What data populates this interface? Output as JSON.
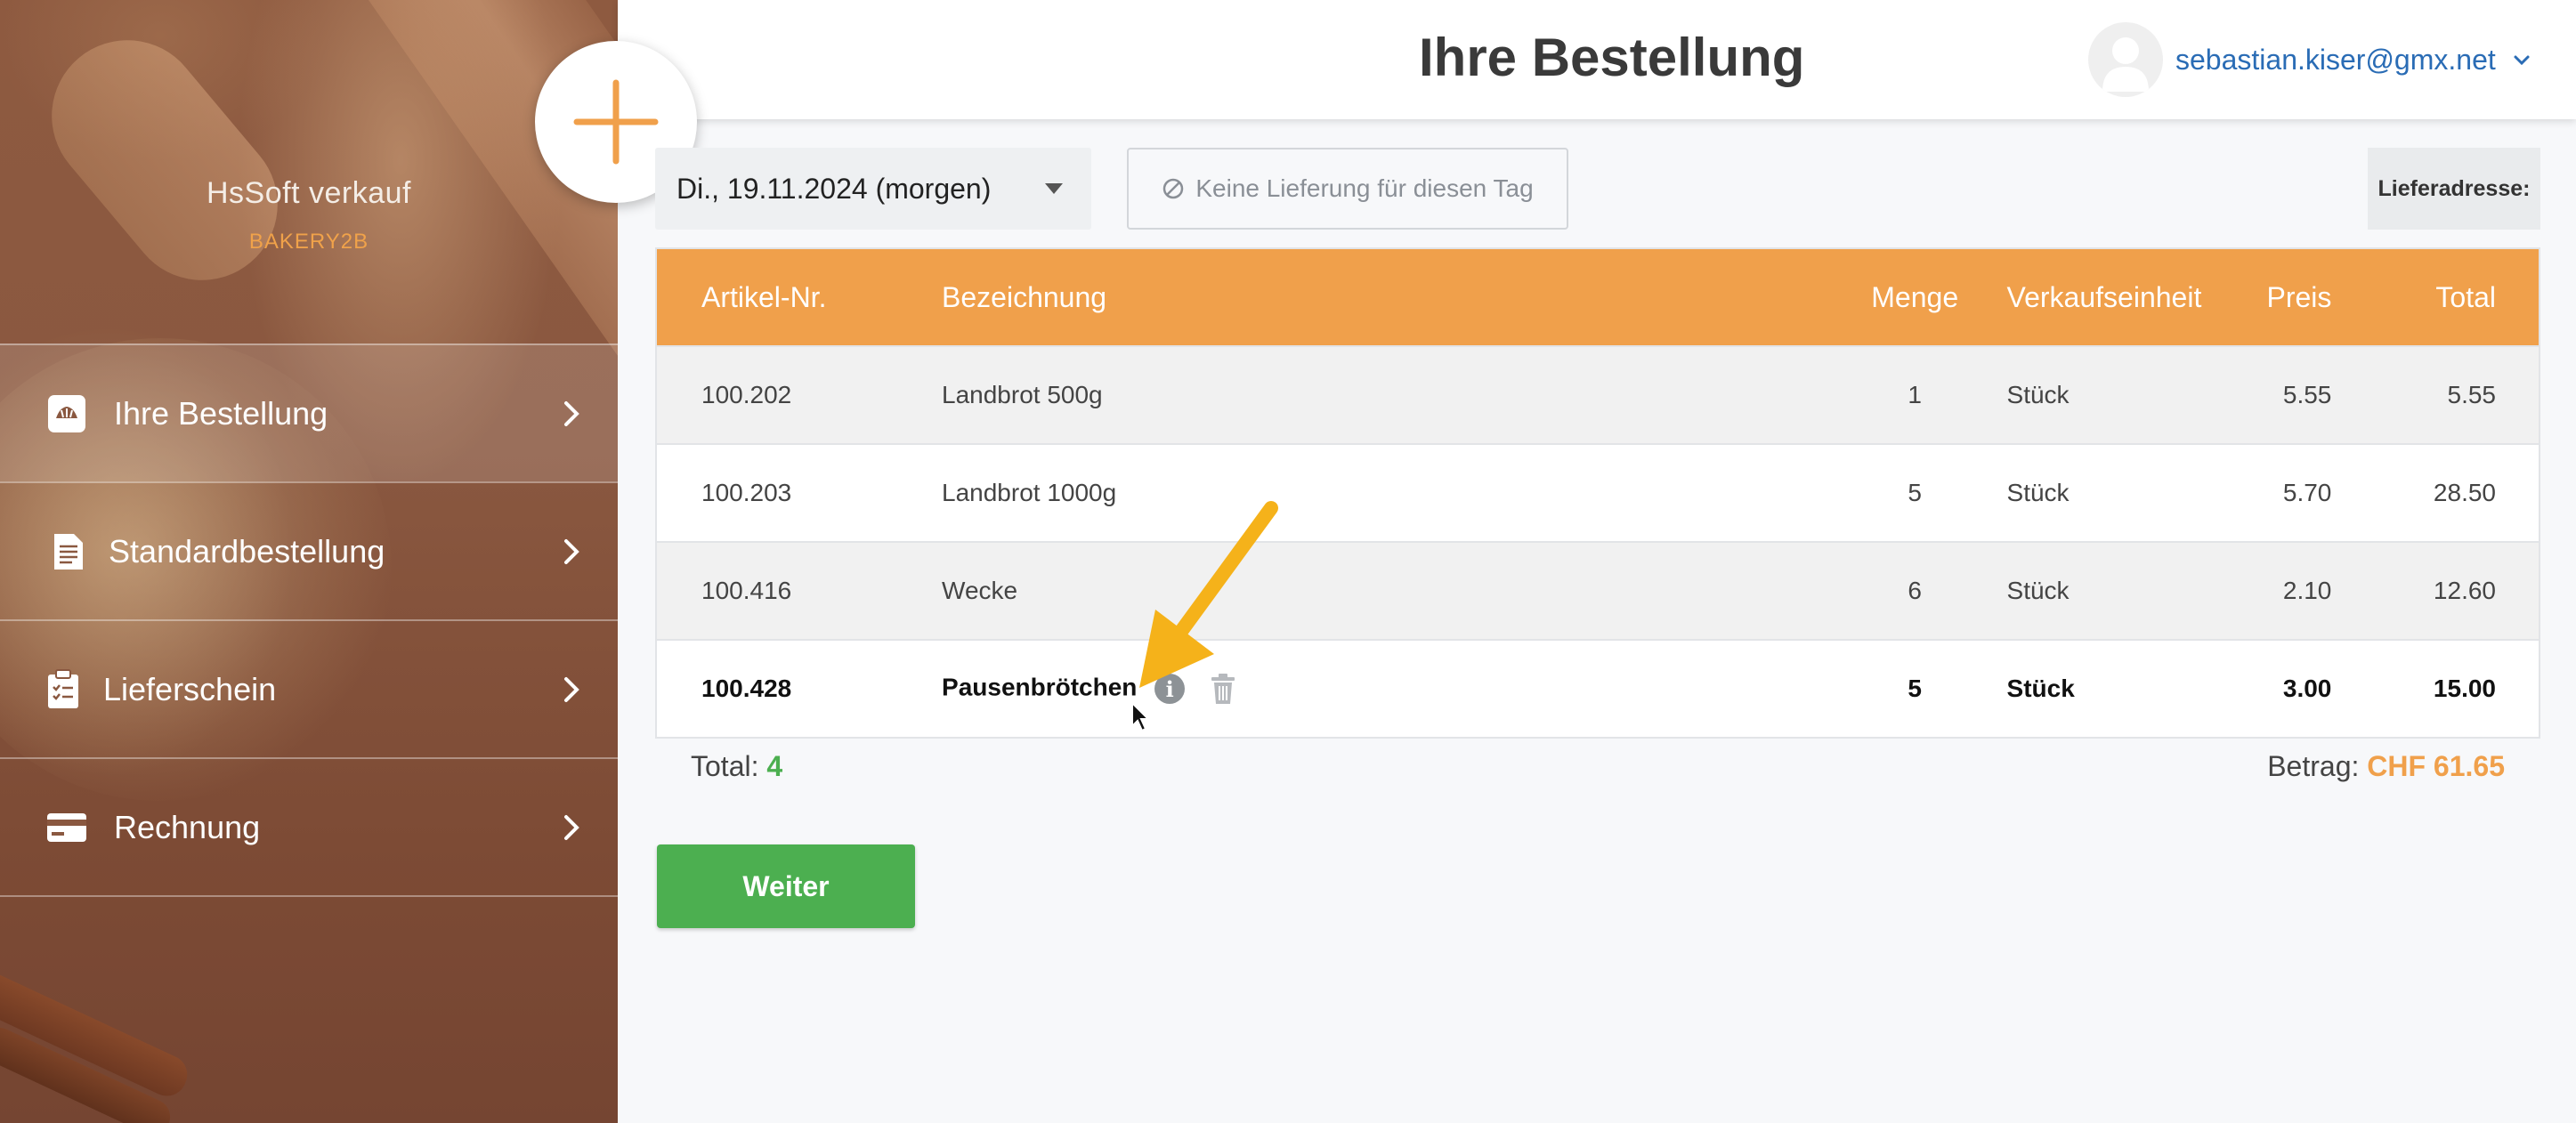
{
  "sidebar": {
    "brand_name": "HsSoft verkauf",
    "brand_subtitle": "BAKERY2B",
    "items": [
      {
        "label": "Ihre Bestellung",
        "icon": "bakery-order-icon",
        "active": true
      },
      {
        "label": "Standardbestellung",
        "icon": "document-icon",
        "active": false
      },
      {
        "label": "Lieferschein",
        "icon": "clipboard-icon",
        "active": false
      },
      {
        "label": "Rechnung",
        "icon": "credit-card-icon",
        "active": false
      }
    ]
  },
  "fab": {
    "icon": "plus-icon",
    "color": "#f0a04b"
  },
  "header": {
    "title": "Ihre Bestellung",
    "user_email": "sebastian.kiser@gmx.net"
  },
  "toolbar": {
    "date_value": "Di., 19.11.2024 (morgen)",
    "no_delivery_label": "Keine Lieferung für diesen Tag",
    "delivery_address_label": "Lieferadresse:"
  },
  "table": {
    "headers": {
      "article_no": "Artikel-Nr.",
      "name": "Bezeichnung",
      "quantity": "Menge",
      "unit": "Verkaufseinheit",
      "price": "Preis",
      "total": "Total"
    },
    "rows": [
      {
        "article_no": "100.202",
        "name": "Landbrot 500g",
        "quantity": "1",
        "unit": "Stück",
        "price": "5.55",
        "total": "5.55"
      },
      {
        "article_no": "100.203",
        "name": "Landbrot 1000g",
        "quantity": "5",
        "unit": "Stück",
        "price": "5.70",
        "total": "28.50"
      },
      {
        "article_no": "100.416",
        "name": "Wecke",
        "quantity": "6",
        "unit": "Stück",
        "price": "2.10",
        "total": "12.60"
      },
      {
        "article_no": "100.428",
        "name": "Pausenbrötchen",
        "quantity": "5",
        "unit": "Stück",
        "price": "3.00",
        "total": "15.00"
      }
    ]
  },
  "summary": {
    "total_label": "Total:",
    "total_count": "4",
    "amount_label": "Betrag:",
    "amount_value": "CHF 61.65"
  },
  "actions": {
    "continue_label": "Weiter"
  },
  "colors": {
    "accent": "#f0a04b",
    "success": "#4caf50",
    "link": "#2a6cb5",
    "annotation": "#f5b21a"
  }
}
